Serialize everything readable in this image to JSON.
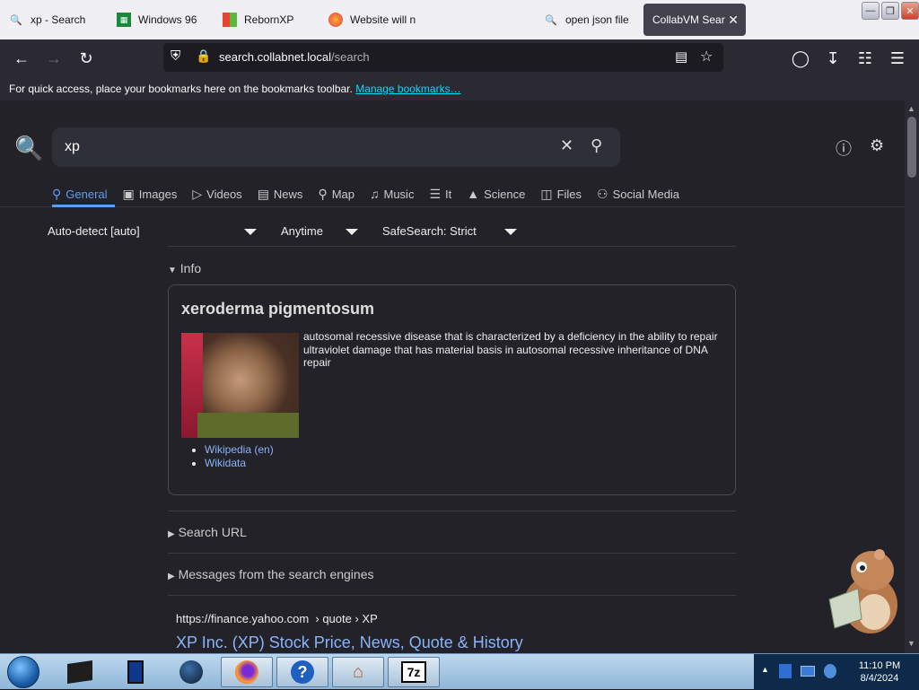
{
  "tabs": [
    {
      "label": "xp - Search",
      "icon": "search-icon"
    },
    {
      "label": "Windows 96",
      "icon": "windows96-icon"
    },
    {
      "label": "RebornXP",
      "icon": "windows-flag-icon"
    },
    {
      "label": "Website will n",
      "icon": "firefox-icon"
    },
    {
      "label": "open json file",
      "icon": "search-icon"
    },
    {
      "label": "CollabVM Sear",
      "icon": "none",
      "active": true
    }
  ],
  "nav": {
    "url_domain": "search.collabnet.local",
    "url_path": "/search"
  },
  "bookmarks": {
    "message": "For quick access, place your bookmarks here on the bookmarks toolbar.",
    "link": "Manage bookmarks…"
  },
  "search": {
    "query": "xp"
  },
  "categories": [
    {
      "label": "General",
      "icon": "search-icon",
      "active": true
    },
    {
      "label": "Images",
      "icon": "image-icon"
    },
    {
      "label": "Videos",
      "icon": "play-icon"
    },
    {
      "label": "News",
      "icon": "newspaper-icon"
    },
    {
      "label": "Map",
      "icon": "map-pin-icon"
    },
    {
      "label": "Music",
      "icon": "music-icon"
    },
    {
      "label": "It",
      "icon": "layers-icon"
    },
    {
      "label": "Science",
      "icon": "graduation-icon"
    },
    {
      "label": "Files",
      "icon": "files-icon"
    },
    {
      "label": "Social Media",
      "icon": "people-icon"
    }
  ],
  "filters": {
    "language": "Auto-detect [auto]",
    "time": "Anytime",
    "safesearch": "SafeSearch: Strict"
  },
  "info": {
    "summary": "Info",
    "title": "xeroderma pigmentosum",
    "description": "autosomal recessive disease that is characterized by a deficiency in the ability to repair ultraviolet damage that has material basis in autosomal recessive inheritance of DNA repair",
    "links": [
      "Wikipedia (en)",
      "Wikidata"
    ]
  },
  "sections": {
    "search_url": "Search URL",
    "messages": "Messages from the search engines"
  },
  "result": {
    "url": "https://finance.yahoo.com",
    "breadcrumb": "› quote › XP",
    "title": "XP Inc. (XP) Stock Price, News, Quote & History"
  },
  "clock": {
    "time": "11:10 PM",
    "date": "8/4/2024"
  },
  "colors": {
    "accent": "#5f9cf5",
    "link": "#8ab4f8",
    "background": "#222228"
  }
}
